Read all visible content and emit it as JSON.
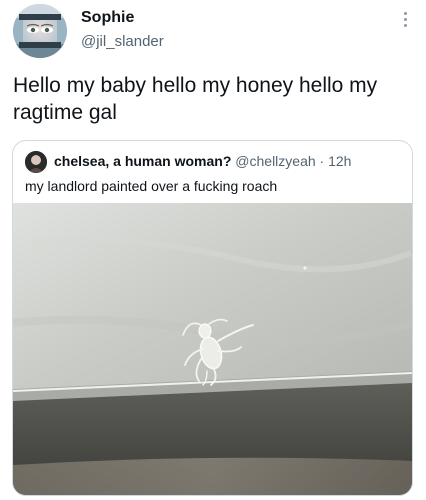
{
  "tweet": {
    "author": {
      "display_name": "Sophie",
      "handle": "@jil_slander",
      "avatar_icon": "profile-photo"
    },
    "more_icon": "more-options-icon",
    "text": "Hello my baby hello my honey hello my ragtime gal"
  },
  "quoted_tweet": {
    "author": {
      "display_name": "chelsea, a human woman?",
      "handle": "@chellzyeah",
      "separator": "·",
      "time": "12h",
      "avatar_icon": "profile-photo"
    },
    "text": "my landlord painted over a fucking roach",
    "media": {
      "kind": "photo",
      "subject": "painted-over-roach-on-wall"
    }
  },
  "colors": {
    "text_primary": "#0f1419",
    "text_secondary": "#536471",
    "border": "#cfd9de"
  }
}
